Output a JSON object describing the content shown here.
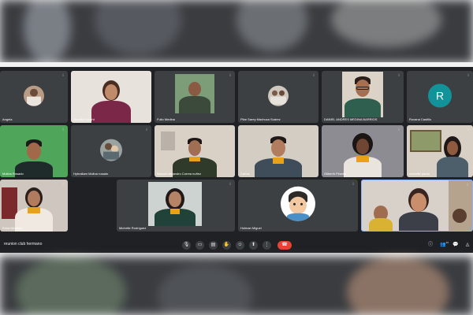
{
  "participants": [
    {
      "name": "Angela"
    },
    {
      "name": "Jennifer Knight"
    },
    {
      "name": "Fullo Medina"
    },
    {
      "name": "Pilar Sarey Machuca Suárez"
    },
    {
      "name": "DANIEL ANDRES MEDINA BARRIOS"
    },
    {
      "name": "Roxana Castillo",
      "initial": "R"
    },
    {
      "name": "Molina Rosado"
    },
    {
      "name": "Hybraliam Molina rosado"
    },
    {
      "name": "Manuel alejandro Correa nuñez"
    },
    {
      "name": "Carlos"
    },
    {
      "name": "Gilberth Pineda"
    },
    {
      "name": "michelle pardo"
    },
    {
      "name": "Erica Morales"
    },
    {
      "name": "Michelle Rodríguez"
    },
    {
      "name": "Holman Miguel"
    },
    {
      "name": ""
    }
  ],
  "meeting": {
    "name": "reunion club hermano"
  },
  "toolbar": {
    "mic_icon": "mic-icon",
    "camera_icon": "camera-icon",
    "captions_icon": "captions-icon",
    "hand_icon": "raise-hand-icon",
    "emoji_icon": "emoji-icon",
    "present_icon": "present-icon",
    "more_icon": "more-options-icon",
    "end_icon": "end-call-icon"
  },
  "right_controls": {
    "info_icon": "info-icon",
    "people_icon": "people-icon",
    "people_count": "16",
    "chat_icon": "chat-icon",
    "activities_icon": "activities-icon"
  },
  "colors": {
    "end_call": "#ea4335",
    "scout_scarf": "#e8a21a",
    "background": "#202124"
  }
}
